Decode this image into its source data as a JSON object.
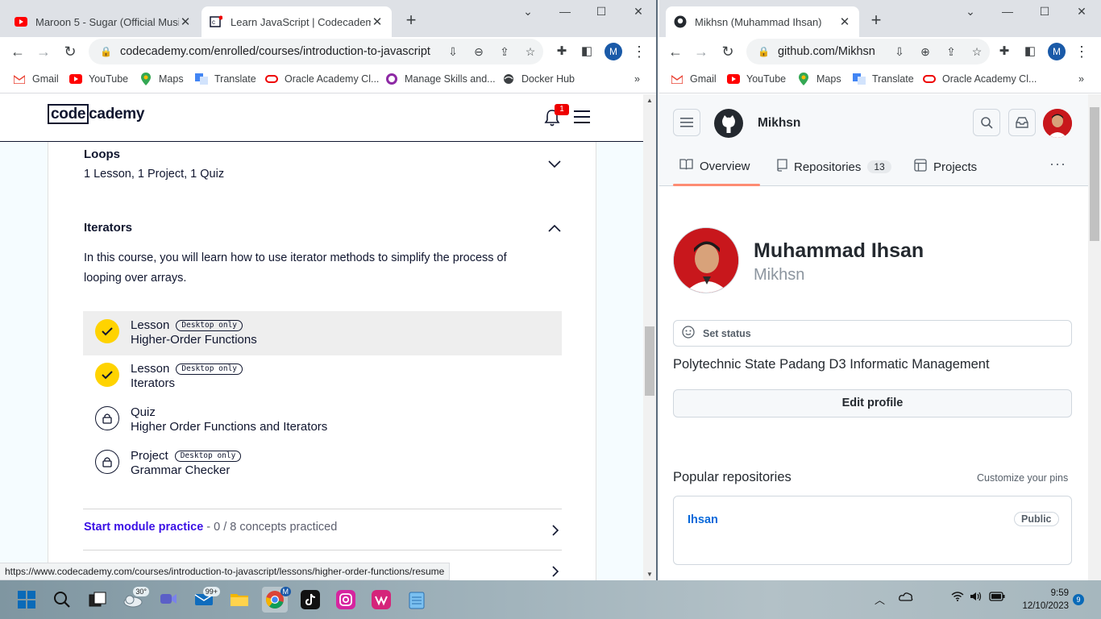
{
  "left_window": {
    "tabs": [
      {
        "label": "Maroon 5 - Sugar (Official Music",
        "icon": "youtube-icon"
      },
      {
        "label": "Learn JavaScript | Codecademy",
        "icon": "codecademy-icon"
      }
    ],
    "url": "codecademy.com/enrolled/courses/introduction-to-javascript",
    "profile_initial": "M",
    "bookmarks": [
      "Gmail",
      "YouTube",
      "Maps",
      "Translate",
      "Oracle Academy Cl...",
      "Manage Skills and...",
      "Docker Hub"
    ],
    "status_url": "https://www.codecademy.com/courses/introduction-to-javascript/lessons/higher-order-functions/resume"
  },
  "codecademy": {
    "logo_code": "code",
    "logo_rest": "cademy",
    "notification_count": "1",
    "loops": {
      "title": "Loops",
      "subtitle": "1 Lesson, 1 Project, 1 Quiz"
    },
    "iterators": {
      "title": "Iterators",
      "description": "In this course, you will learn how to use iterator methods to simplify the process of looping over arrays.",
      "items": [
        {
          "kind": "Lesson",
          "tag": "Desktop only",
          "title": "Higher-Order Functions",
          "state": "done"
        },
        {
          "kind": "Lesson",
          "tag": "Desktop only",
          "title": "Iterators",
          "state": "done"
        },
        {
          "kind": "Quiz",
          "tag": "",
          "title": "Higher Order Functions and Iterators",
          "state": "locked"
        },
        {
          "kind": "Project",
          "tag": "Desktop only",
          "title": "Grammar Checker",
          "state": "locked"
        }
      ]
    },
    "practice": {
      "link": "Start module practice",
      "sep": " - ",
      "progress": "0 / 8 concepts practiced"
    }
  },
  "right_window": {
    "tab_label": "Mikhsn (Muhammad Ihsan)",
    "url": "github.com/Mikhsn",
    "profile_initial": "M",
    "bookmarks": [
      "Gmail",
      "YouTube",
      "Maps",
      "Translate",
      "Oracle Academy Cl..."
    ]
  },
  "github": {
    "header_user": "Mikhsn",
    "tabs": {
      "overview": "Overview",
      "repositories": "Repositories",
      "repo_count": "13",
      "projects": "Projects"
    },
    "name": "Muhammad Ihsan",
    "login": "Mikhsn",
    "set_status": "Set status",
    "bio": "Polytechnic State Padang D3 Informatic Management",
    "edit_profile": "Edit profile",
    "popular": "Popular repositories",
    "customize": "Customize your pins",
    "repo": {
      "name": "Ihsan",
      "visibility": "Public"
    }
  },
  "taskbar": {
    "weather_temp": "30°",
    "mail_badge": "99+",
    "time": "9:59",
    "date": "12/10/2023",
    "notifications": "9"
  },
  "colors": {
    "codecademy_link": "#3a10e5",
    "checkmark_yellow": "#ffd300",
    "github_link": "#0969da",
    "github_tab_accent": "#fd8c73"
  }
}
